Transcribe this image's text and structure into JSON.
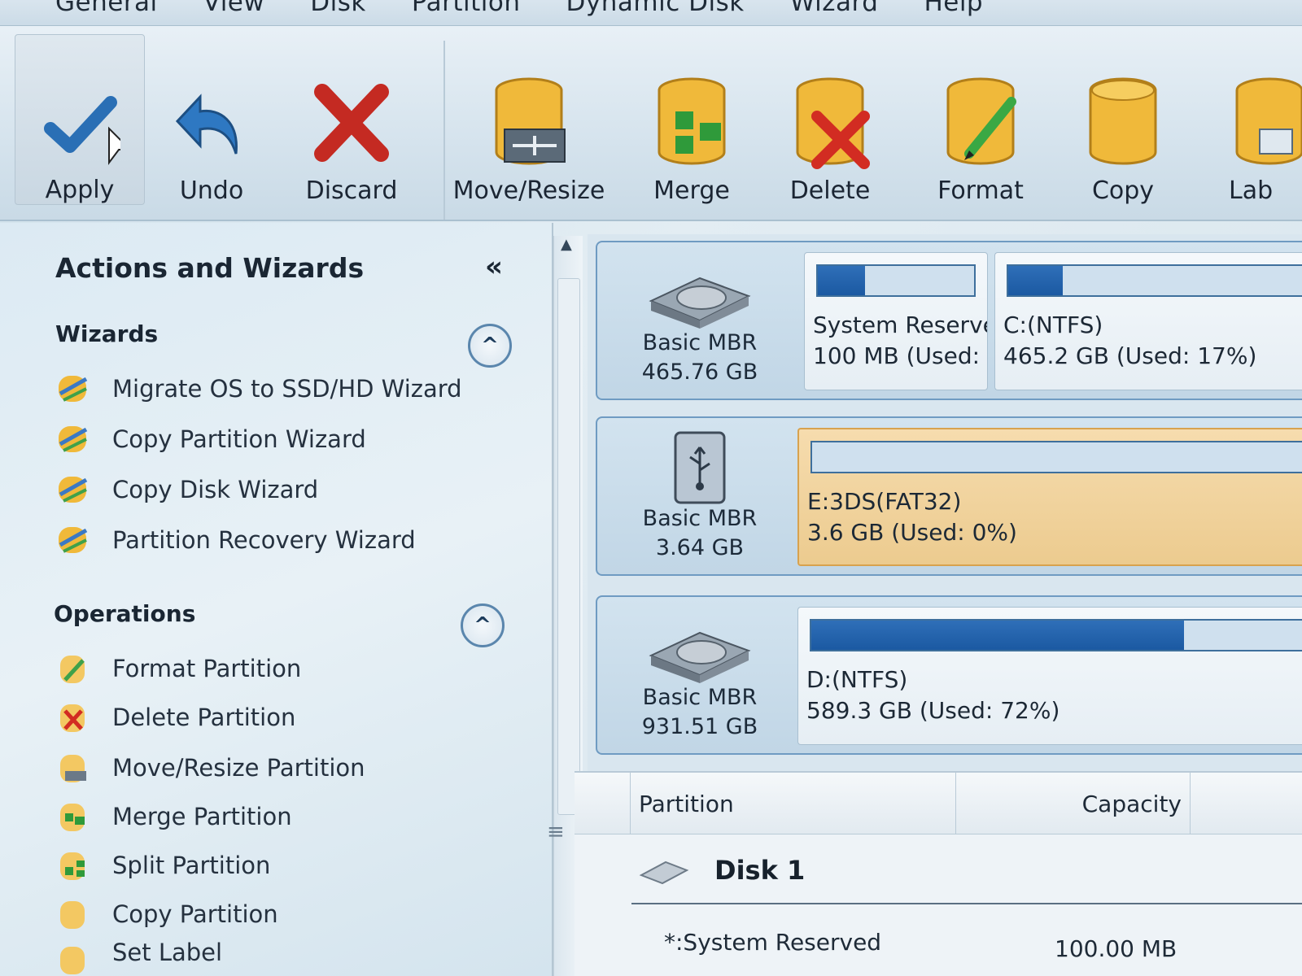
{
  "menu": [
    "General",
    "View",
    "Disk",
    "Partition",
    "Dynamic Disk",
    "Wizard",
    "Help"
  ],
  "toolbar": {
    "apply": "Apply",
    "undo": "Undo",
    "discard": "Discard",
    "move_resize": "Move/Resize",
    "merge": "Merge",
    "delete": "Delete",
    "format": "Format",
    "copy": "Copy",
    "label": "Lab"
  },
  "panel": {
    "title": "Actions and Wizards",
    "collapse_glyph": "«",
    "wizards_heading": "Wizards",
    "wizards": [
      "Migrate OS to SSD/HD Wizard",
      "Copy Partition Wizard",
      "Copy Disk Wizard",
      "Partition Recovery Wizard"
    ],
    "operations_heading": "Operations",
    "operations": [
      "Format Partition",
      "Delete Partition",
      "Move/Resize Partition",
      "Merge Partition",
      "Split Partition",
      "Copy Partition",
      "Set Label"
    ],
    "toggle_glyph": "^"
  },
  "disks": [
    {
      "type": "Basic MBR",
      "size": "465.76 GB",
      "icon": "hard-disk-icon",
      "partitions": [
        {
          "name": "System Reserved",
          "info": "100 MB (Used:",
          "used": 0.3
        },
        {
          "name": "C:(NTFS)",
          "info": "465.2 GB (Used: 17%)",
          "used": 0.17
        }
      ]
    },
    {
      "type": "Basic MBR",
      "size": "3.64 GB",
      "icon": "usb-disk-icon",
      "partitions": [
        {
          "name": "E:3DS(FAT32)",
          "info": "3.6 GB (Used: 0%)",
          "used": 0.0,
          "selected": true
        }
      ]
    },
    {
      "type": "Basic MBR",
      "size": "931.51 GB",
      "icon": "hard-disk-icon",
      "partitions": [
        {
          "name": "D:(NTFS)",
          "info": "589.3 GB (Used: 72%)",
          "used": 0.72
        }
      ]
    }
  ],
  "table": {
    "col_partition": "Partition",
    "col_capacity": "Capacity",
    "group": "Disk 1",
    "rows": [
      {
        "partition": "*:System Reserved",
        "capacity": "100.00 MB"
      }
    ]
  },
  "colors": {
    "accent_blue": "#1b59a2",
    "selected_partition": "#eccb8f"
  }
}
